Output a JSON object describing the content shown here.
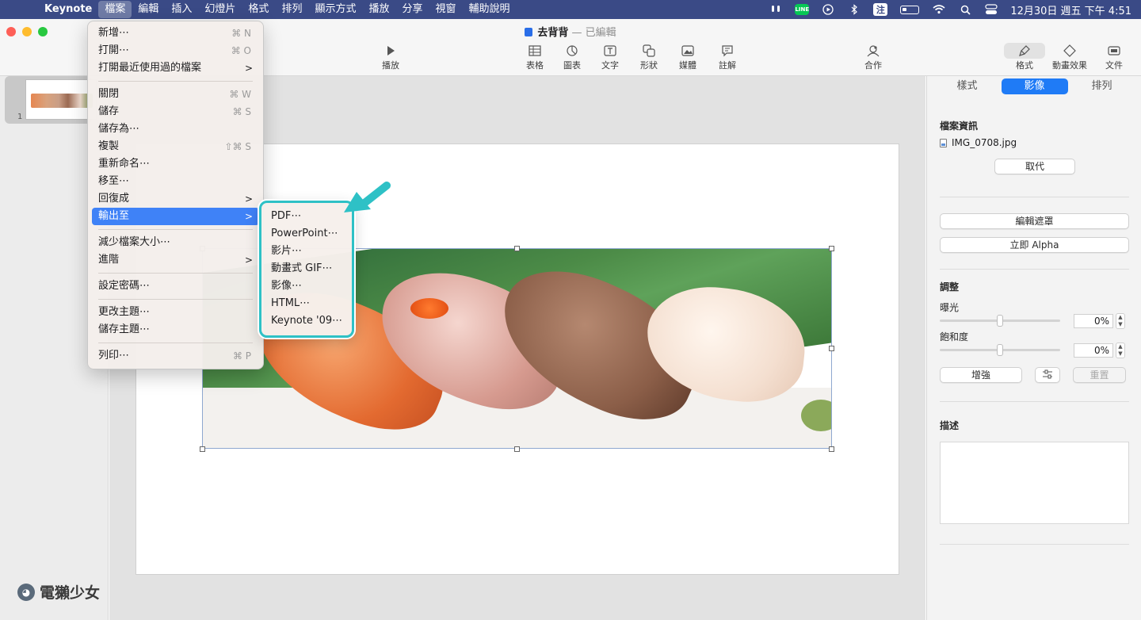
{
  "menubar": {
    "app": "Keynote",
    "items": [
      "檔案",
      "編輯",
      "插入",
      "幻燈片",
      "格式",
      "排列",
      "顯示方式",
      "播放",
      "分享",
      "視窗",
      "輔助說明"
    ],
    "status": {
      "line": "LINE",
      "zhu": "注"
    },
    "clock": "12月30日 週五 下午 4:51"
  },
  "window": {
    "doc_name": "去背背",
    "separator": "—",
    "doc_status": "已編輯"
  },
  "toolbar": {
    "play": "播放",
    "table": "表格",
    "chart": "圖表",
    "text": "文字",
    "shape": "形狀",
    "media": "媒體",
    "comment": "註解",
    "collaborate": "合作",
    "format": "格式",
    "animate": "動畫效果",
    "document": "文件"
  },
  "navigator": {
    "slide_number": "1"
  },
  "watermark": {
    "text": "電獺少女"
  },
  "file_menu": {
    "items": [
      {
        "label": "新增⋯",
        "shortcut": "⌘ N"
      },
      {
        "label": "打開⋯",
        "shortcut": "⌘ O"
      },
      {
        "label": "打開最近使用過的檔案",
        "arrow": ">"
      },
      {
        "label": "關閉",
        "shortcut": "⌘ W"
      },
      {
        "label": "儲存",
        "shortcut": "⌘ S"
      },
      {
        "label": "儲存為⋯"
      },
      {
        "label": "複製",
        "shortcut": "⇧⌘ S"
      },
      {
        "label": "重新命名⋯"
      },
      {
        "label": "移至⋯"
      },
      {
        "label": "回復成",
        "arrow": ">"
      },
      {
        "label": "輸出至",
        "arrow": ">"
      },
      {
        "label": "減少檔案大小⋯"
      },
      {
        "label": "進階",
        "arrow": ">"
      },
      {
        "label": "設定密碼⋯"
      },
      {
        "label": "更改主題⋯"
      },
      {
        "label": "儲存主題⋯"
      },
      {
        "label": "列印⋯",
        "shortcut": "⌘ P"
      }
    ]
  },
  "export_submenu": {
    "items": [
      "PDF⋯",
      "PowerPoint⋯",
      "影片⋯",
      "動畫式 GIF⋯",
      "影像⋯",
      "HTML⋯",
      "Keynote '09⋯"
    ]
  },
  "inspector": {
    "tabs": [
      "樣式",
      "影像",
      "排列"
    ],
    "active_tab": "影像",
    "file_info_title": "檔案資訊",
    "filename": "IMG_0708.jpg",
    "replace": "取代",
    "edit_mask": "編輯遮罩",
    "instant_alpha": "立即 Alpha",
    "adjust_title": "調整",
    "exposure_label": "曝光",
    "exposure_value": "0%",
    "saturation_label": "飽和度",
    "saturation_value": "0%",
    "enhance": "增強",
    "reset": "重置",
    "description_title": "描述"
  },
  "colors": {
    "menubar": "#3a4a86",
    "accent": "#1f7bf6",
    "highlight": "#2ec1c6"
  }
}
